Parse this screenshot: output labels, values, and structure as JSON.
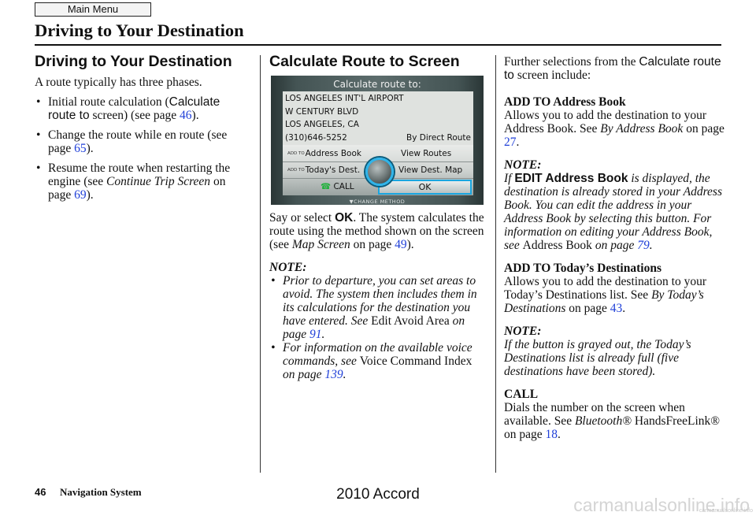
{
  "header": {
    "main_menu_label": "Main Menu",
    "page_title": "Driving to Your Destination"
  },
  "col1": {
    "heading": "Driving to Your Destination",
    "intro": "A route typically has three phases.",
    "bullets": [
      {
        "pre": "Initial route calculation (",
        "ui": "Calculate route to",
        "mid": " screen) (see page ",
        "link": "46",
        "post": ")."
      },
      {
        "pre": "Change the route while en route (see page ",
        "link": "65",
        "post": ")."
      },
      {
        "pre": "Resume the route when restarting the engine (see ",
        "italic": "Continue Trip Screen",
        "mid": " on page ",
        "link": "69",
        "post": ")."
      }
    ]
  },
  "col2": {
    "heading": "Calculate Route to Screen",
    "nav_screen": {
      "title": "Calculate route to:",
      "lines": [
        "LOS ANGELES INT'L AIRPORT",
        "W CENTURY BLVD",
        "LOS ANGELES, CA"
      ],
      "phone": "(310)646-5252",
      "method": "By Direct Route",
      "add_to_label": "ADD TO",
      "btn_address_book": "Address Book",
      "btn_view_routes": "View Routes",
      "btn_todays_dest": "Today's Dest.",
      "btn_view_dest_map": "View Dest. Map",
      "btn_call": "CALL",
      "btn_ok": "OK",
      "change_method": "CHANGE METHOD"
    },
    "para_pre": "Say or select ",
    "para_ui": "OK",
    "para_mid": ". The system calculates the route using the method shown on the screen (see ",
    "para_italic": "Map Screen",
    "para_mid2": " on page ",
    "para_link": "49",
    "para_post": ").",
    "note_label": "NOTE:",
    "notes": [
      {
        "pre": "Prior to departure, you can set areas to avoid. The system then includes them in its calculations for the destination you have entered. See ",
        "roman": "Edit Avoid Area",
        "mid": " on page ",
        "link": "91",
        "post": "."
      },
      {
        "pre": "For information on the available voice commands, see ",
        "roman": "Voice Command Index",
        "mid": " on page ",
        "link": "139",
        "post": "."
      }
    ]
  },
  "col3": {
    "intro_pre": "Further selections from the ",
    "intro_ui": "Calculate route to",
    "intro_post": " screen include:",
    "add_address_heading": "ADD TO Address Book",
    "add_address_pre": "Allows you to add the destination to your Address Book. See ",
    "add_address_italic": "By Address Book",
    "add_address_mid": " on page ",
    "add_address_link": "27",
    "add_address_post": ".",
    "note1_label": "NOTE:",
    "note1_pre": "If ",
    "note1_ui": "EDIT Address Book",
    "note1_mid": " is displayed, the destination is already stored in your Address Book. You can edit the address in your Address Book by selecting this button. For information on editing your Address Book, see ",
    "note1_roman": "Address Book",
    "note1_mid2": " on page ",
    "note1_link": "79",
    "note1_post": ".",
    "add_today_heading": "ADD TO Today’s Destinations",
    "add_today_pre": "Allows you to add the destination to your Today’s Destinations list. See ",
    "add_today_italic": "By Today’s Destinations",
    "add_today_mid": " on page ",
    "add_today_link": "43",
    "add_today_post": ".",
    "note2_label": "NOTE:",
    "note2_text": "If the button is grayed out, the Today’s Destinations list is already full (five destinations have been stored).",
    "call_heading": "CALL",
    "call_pre": "Dials the number on the screen when available. See ",
    "call_italic": "Bluetooth®",
    "call_mid": " HandsFreeLink® on page ",
    "call_link": "18",
    "call_post": "."
  },
  "footer": {
    "page_number": "46",
    "section": "Navigation System",
    "model": "2010 Accord",
    "watermark": "carmanualsonline.info",
    "watermark_small": "carmanualsonline.info"
  },
  "colors": {
    "link": "#2040d8",
    "nav_highlight": "#1aa6e0",
    "call_icon": "#1fb13a"
  }
}
